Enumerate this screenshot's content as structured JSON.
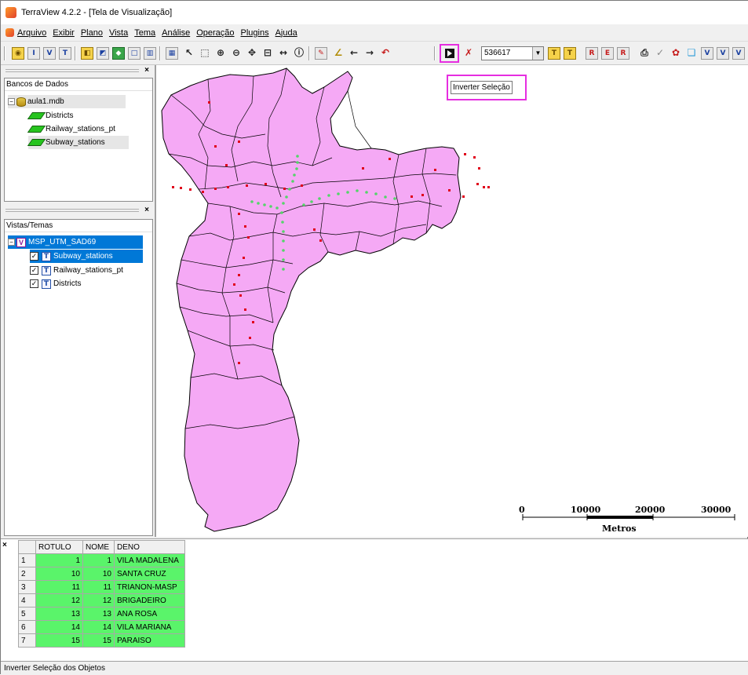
{
  "window": {
    "title": "TerraView 4.2.2 - [Tela de Visualização]"
  },
  "menu": [
    "Arquivo",
    "Exibir",
    "Plano",
    "Vista",
    "Tema",
    "Análise",
    "Operação",
    "Plugins",
    "Ajuda"
  ],
  "toolbar": {
    "scale_value": "536617",
    "tooltip": "Inverter Seleção"
  },
  "databases_panel": {
    "header": "Bancos de Dados",
    "db_name": "aula1.mdb",
    "layers": [
      "Districts",
      "Railway_stations_pt",
      "Subway_stations"
    ]
  },
  "views_panel": {
    "header": "Vistas/Temas",
    "view_name": "MSP_UTM_SAD69",
    "themes": [
      "Subway_stations",
      "Railway_stations_pt",
      "Districts"
    ]
  },
  "map": {
    "fill_color": "#f5a9f5",
    "boundary_color": "#000000",
    "railway_point_color": "#e0001a",
    "subway_point_color": "#55d46a",
    "scale_bar": {
      "ticks": [
        "0",
        "10000",
        "20000",
        "30000"
      ],
      "unit": "Metros"
    }
  },
  "table": {
    "columns": [
      "ROTULO",
      "NOME",
      "DENO"
    ],
    "rows": [
      {
        "n": "1",
        "rotulo": "1",
        "nome": "1",
        "deno": "VILA MADALENA"
      },
      {
        "n": "2",
        "rotulo": "10",
        "nome": "10",
        "deno": "SANTA CRUZ"
      },
      {
        "n": "3",
        "rotulo": "11",
        "nome": "11",
        "deno": "TRIANON-MASP"
      },
      {
        "n": "4",
        "rotulo": "12",
        "nome": "12",
        "deno": "BRIGADEIRO"
      },
      {
        "n": "5",
        "rotulo": "13",
        "nome": "13",
        "deno": "ANA ROSA"
      },
      {
        "n": "6",
        "rotulo": "14",
        "nome": "14",
        "deno": "VILA MARIANA"
      },
      {
        "n": "7",
        "rotulo": "15",
        "nome": "15",
        "deno": "PARAISO"
      }
    ],
    "selection_color": "#5af46a"
  },
  "status": "Inverter Seleção dos Objetos"
}
